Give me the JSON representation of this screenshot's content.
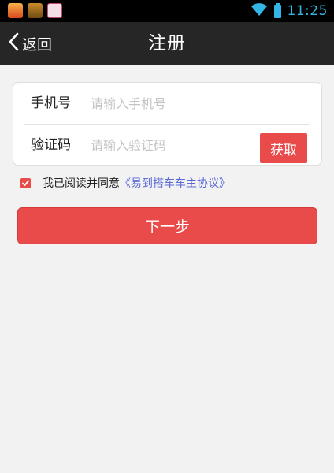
{
  "status_bar": {
    "time": "11:25",
    "left_icons": [
      "app-icon-1",
      "app-icon-2",
      "app-icon-3"
    ],
    "right_icons": [
      "wifi-icon",
      "battery-icon"
    ]
  },
  "header": {
    "back_label": "返回",
    "title": "注册"
  },
  "form": {
    "phone_label": "手机号",
    "phone_placeholder": "请输入手机号",
    "phone_value": "",
    "code_label": "验证码",
    "code_placeholder": "请输入验证码",
    "code_value": "",
    "get_code_label": "获取"
  },
  "agreement": {
    "checked": true,
    "text": "我已阅读并同意",
    "link": "《易到搭车车主协议》"
  },
  "next_button_label": "下一步",
  "colors": {
    "accent": "#e94a4a",
    "link": "#5b6bd6",
    "status_blue": "#33b5e5",
    "title_bar": "#262626",
    "background": "#f2f2f2"
  }
}
